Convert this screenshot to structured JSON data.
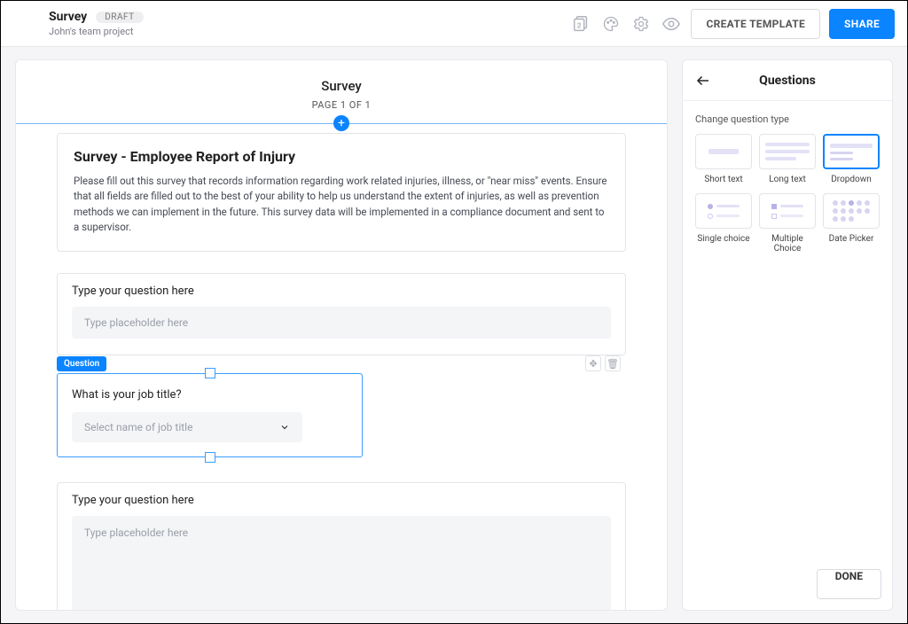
{
  "header": {
    "title": "Survey",
    "status": "DRAFT",
    "subtitle": "John's team project",
    "pages_badge": "2",
    "create_template": "CREATE TEMPLATE",
    "share": "SHARE"
  },
  "canvas": {
    "title": "Survey",
    "page_counter": "PAGE 1 OF 1",
    "intro": {
      "heading": "Survey - Employee Report of Injury",
      "body": "Please fill out this survey that records information regarding work related injuries, illness, or \"near miss\" events. Ensure that all fields are filled out to the best of your ability to help us understand the extent of injuries, as well as prevention methods we can implement in the future. This survey data will be implemented in a compliance document and sent to a supervisor."
    },
    "questions": [
      {
        "prompt": "Type your question here",
        "placeholder": "Type placeholder here"
      },
      {
        "prompt": "What is your job title?",
        "placeholder": "Select name of job title",
        "tag": "Question"
      },
      {
        "prompt": "Type your question here",
        "placeholder": "Type placeholder here"
      }
    ]
  },
  "aside": {
    "title": "Questions",
    "subtitle": "Change question type",
    "types": [
      {
        "label": "Short text"
      },
      {
        "label": "Long text"
      },
      {
        "label": "Dropdown",
        "selected": true
      },
      {
        "label": "Single choice"
      },
      {
        "label": "Multiple Choice"
      },
      {
        "label": "Date Picker"
      }
    ],
    "done": "DONE"
  }
}
